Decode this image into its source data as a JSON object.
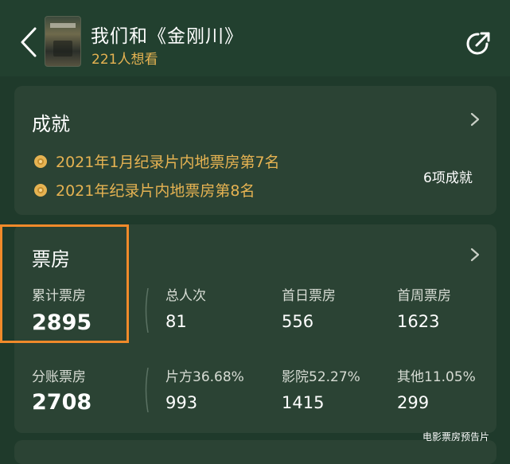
{
  "header": {
    "title": "我们和《金刚川》",
    "want_to_see": "221人想看",
    "icons": {
      "back": "back-chevron-icon",
      "share": "share-icon"
    }
  },
  "achievements": {
    "title": "成就",
    "items": [
      {
        "text": "2021年1月纪录片内地票房第7名",
        "icon": "medal-icon"
      },
      {
        "text": "2021年纪录片内地票房第8名",
        "icon": "medal-icon"
      }
    ],
    "count_label": "6项成就"
  },
  "box_office": {
    "title": "票房",
    "cumulative": {
      "label": "累计票房",
      "value": "2895"
    },
    "stats_row1": [
      {
        "label": "总人次",
        "value": "81"
      },
      {
        "label": "首日票房",
        "value": "556"
      },
      {
        "label": "首周票房",
        "value": "1623"
      }
    ],
    "split": {
      "label": "分账票房",
      "value": "2708"
    },
    "stats_row2": [
      {
        "label": "片方36.68%",
        "value": "993"
      },
      {
        "label": "影院52.27%",
        "value": "1415"
      },
      {
        "label": "其他11.05%",
        "value": "299"
      }
    ]
  },
  "watermark": "电影票房预告片",
  "colors": {
    "background": "#1f3a2b",
    "card": "#2b4334",
    "accent_gold": "#e6b352",
    "highlight_orange": "#f08a2a"
  }
}
